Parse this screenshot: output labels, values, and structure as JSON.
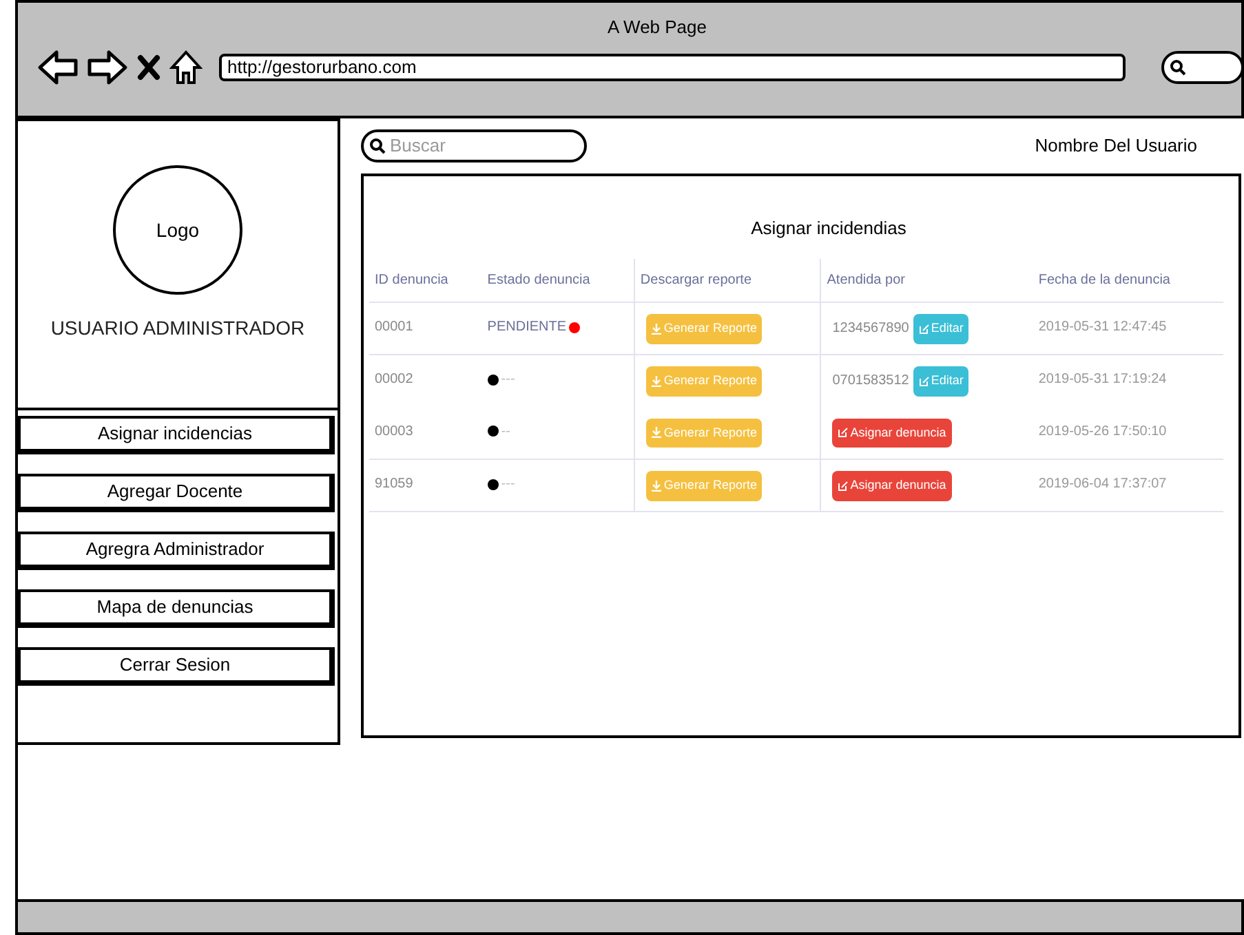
{
  "window": {
    "title": "A Web Page",
    "url": "http://gestorurbano.com"
  },
  "sidebar": {
    "logo": "Logo",
    "role": "USUARIO ADMINISTRADOR",
    "items": [
      {
        "label": "Asignar incidencias"
      },
      {
        "label": "Agregar Docente"
      },
      {
        "label": "Agregra Administrador"
      },
      {
        "label": "Mapa de denuncias"
      },
      {
        "label": "Cerrar Sesion"
      }
    ]
  },
  "search": {
    "placeholder": "Buscar"
  },
  "user_name": "Nombre Del Usuario",
  "table": {
    "title": "Asignar incidendias",
    "columns": [
      "ID denuncia",
      "Estado denuncia",
      "Descargar reporte",
      "Atendida por",
      "Fecha de la denuncia"
    ],
    "rows": [
      {
        "id": "00001",
        "status": {
          "kind": "pending",
          "text": "PENDIENTE",
          "color": "#ff0000"
        },
        "report": "Generar Reporte",
        "attended": {
          "kind": "assigned",
          "text": "1234567890",
          "button": "Editar"
        },
        "date": "2019-05-31 12:47:45"
      },
      {
        "id": "00002",
        "status": {
          "kind": "none",
          "text": "---",
          "color": "#000000"
        },
        "report": "Generar Reporte",
        "attended": {
          "kind": "assigned",
          "text": "0701583512",
          "button": "Editar"
        },
        "date": "2019-05-31 17:19:24"
      },
      {
        "id": "00003",
        "status": {
          "kind": "none",
          "text": "--",
          "color": "#000000"
        },
        "report": "Generar Reporte",
        "attended": {
          "kind": "unassigned",
          "button": "Asignar denuncia"
        },
        "date": "2019-05-26 17:50:10"
      },
      {
        "id": "91059",
        "status": {
          "kind": "none",
          "text": "---",
          "color": "#000000"
        },
        "report": "Generar Reporte",
        "attended": {
          "kind": "unassigned",
          "button": "Asignar denuncia"
        },
        "date": "2019-06-04 17:37:07"
      }
    ]
  }
}
